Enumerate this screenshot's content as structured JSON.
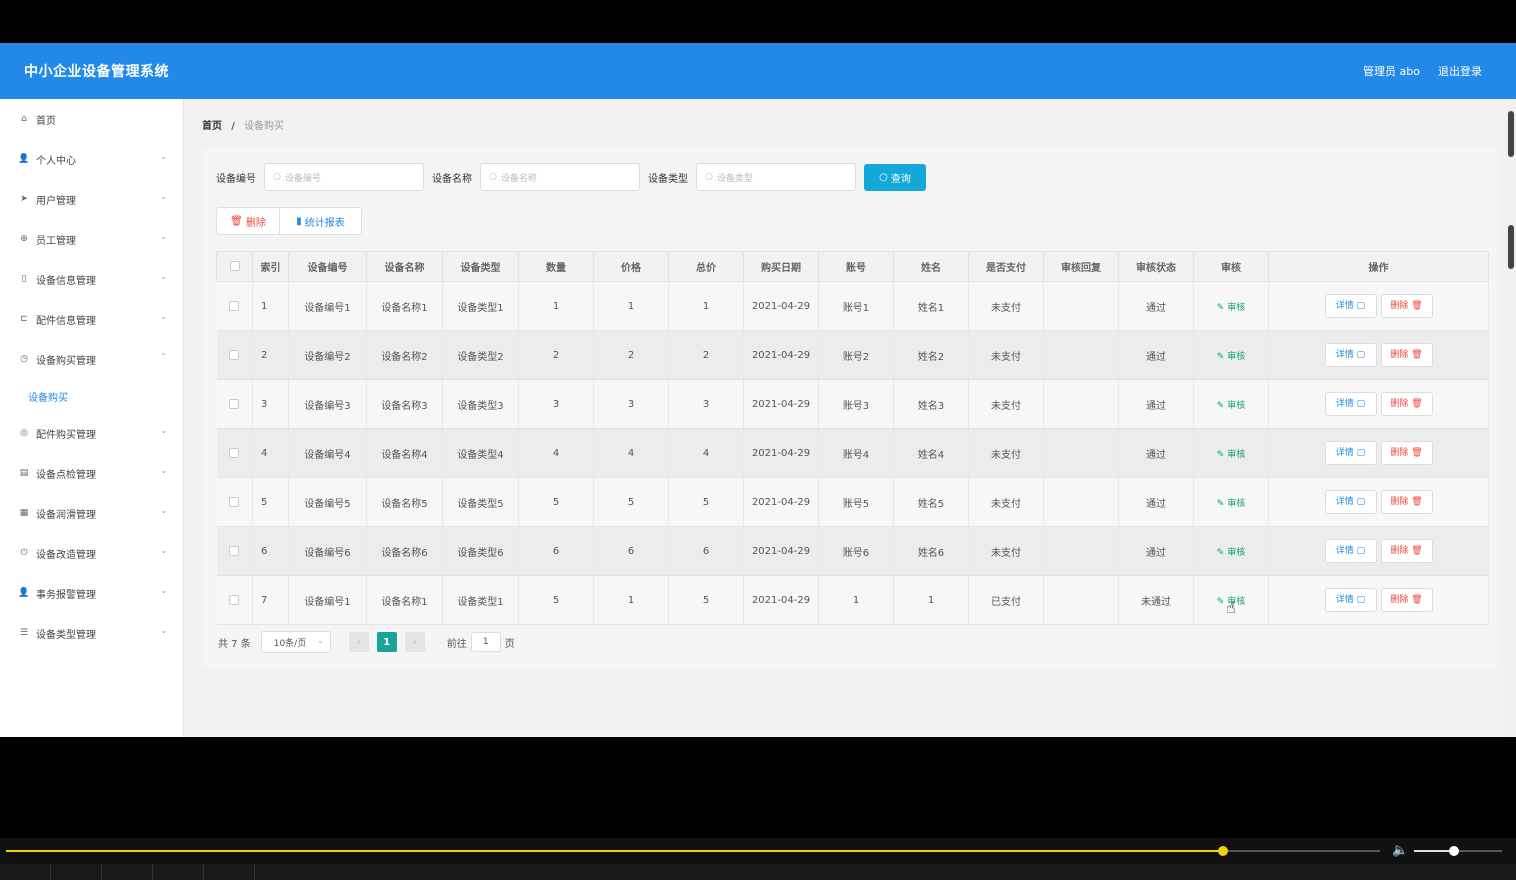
{
  "header": {
    "title": "中小企业设备管理系统",
    "user": "管理员 abo",
    "logout": "退出登录"
  },
  "sidebar": {
    "items": [
      {
        "label": "首页",
        "icon": "home-icon",
        "glyph": "⌂",
        "has_sub": false
      },
      {
        "label": "个人中心",
        "icon": "user-icon",
        "glyph": "👤",
        "has_sub": true
      },
      {
        "label": "用户管理",
        "icon": "send-icon",
        "glyph": "➤",
        "has_sub": true
      },
      {
        "label": "员工管理",
        "icon": "compass-icon",
        "glyph": "⊕",
        "has_sub": true
      },
      {
        "label": "设备信息管理",
        "icon": "phone-icon",
        "glyph": "▯",
        "has_sub": true
      },
      {
        "label": "配件信息管理",
        "icon": "crop-icon",
        "glyph": "⊏",
        "has_sub": true
      },
      {
        "label": "设备购买管理",
        "icon": "clock-icon",
        "glyph": "◷",
        "has_sub": true,
        "expanded": true
      },
      {
        "label": "配件购买管理",
        "icon": "dial-icon",
        "glyph": "◎",
        "has_sub": true
      },
      {
        "label": "设备点检管理",
        "icon": "clipboard-icon",
        "glyph": "▤",
        "has_sub": true
      },
      {
        "label": "设备润滑管理",
        "icon": "chart-icon",
        "glyph": "▦",
        "has_sub": true
      },
      {
        "label": "设备改造管理",
        "icon": "power-icon",
        "glyph": "⏻",
        "has_sub": true
      },
      {
        "label": "事务报警管理",
        "icon": "person-icon",
        "glyph": "👤",
        "has_sub": true
      },
      {
        "label": "设备类型管理",
        "icon": "list-icon",
        "glyph": "☰",
        "has_sub": true
      }
    ],
    "submenu_active": "设备购买"
  },
  "breadcrumb": {
    "home": "首页",
    "sep": "/",
    "current": "设备购买"
  },
  "search": {
    "fields": [
      {
        "label": "设备编号",
        "placeholder": "设备编号"
      },
      {
        "label": "设备名称",
        "placeholder": "设备名称"
      },
      {
        "label": "设备类型",
        "placeholder": "设备类型"
      }
    ],
    "query_button": "查询"
  },
  "actions": {
    "delete": "删除",
    "report": "统计报表"
  },
  "table": {
    "columns": [
      "索引",
      "设备编号",
      "设备名称",
      "设备类型",
      "数量",
      "价格",
      "总价",
      "购买日期",
      "账号",
      "姓名",
      "是否支付",
      "审核回复",
      "审核状态",
      "审核",
      "操作"
    ],
    "audit_link": "审核",
    "detail_button": "详情",
    "delete_button": "删除",
    "rows": [
      {
        "idx": "1",
        "code": "设备编号1",
        "name": "设备名称1",
        "type": "设备类型1",
        "qty": "1",
        "price": "1",
        "total": "1",
        "date": "2021-04-29",
        "account": "账号1",
        "person": "姓名1",
        "paid": "未支付",
        "reply": "",
        "status": "通过"
      },
      {
        "idx": "2",
        "code": "设备编号2",
        "name": "设备名称2",
        "type": "设备类型2",
        "qty": "2",
        "price": "2",
        "total": "2",
        "date": "2021-04-29",
        "account": "账号2",
        "person": "姓名2",
        "paid": "未支付",
        "reply": "",
        "status": "通过"
      },
      {
        "idx": "3",
        "code": "设备编号3",
        "name": "设备名称3",
        "type": "设备类型3",
        "qty": "3",
        "price": "3",
        "total": "3",
        "date": "2021-04-29",
        "account": "账号3",
        "person": "姓名3",
        "paid": "未支付",
        "reply": "",
        "status": "通过"
      },
      {
        "idx": "4",
        "code": "设备编号4",
        "name": "设备名称4",
        "type": "设备类型4",
        "qty": "4",
        "price": "4",
        "total": "4",
        "date": "2021-04-29",
        "account": "账号4",
        "person": "姓名4",
        "paid": "未支付",
        "reply": "",
        "status": "通过"
      },
      {
        "idx": "5",
        "code": "设备编号5",
        "name": "设备名称5",
        "type": "设备类型5",
        "qty": "5",
        "price": "5",
        "total": "5",
        "date": "2021-04-29",
        "account": "账号5",
        "person": "姓名5",
        "paid": "未支付",
        "reply": "",
        "status": "通过"
      },
      {
        "idx": "6",
        "code": "设备编号6",
        "name": "设备名称6",
        "type": "设备类型6",
        "qty": "6",
        "price": "6",
        "total": "6",
        "date": "2021-04-29",
        "account": "账号6",
        "person": "姓名6",
        "paid": "未支付",
        "reply": "",
        "status": "通过"
      },
      {
        "idx": "7",
        "code": "设备编号1",
        "name": "设备名称1",
        "type": "设备类型1",
        "qty": "5",
        "price": "1",
        "total": "5",
        "date": "2021-04-29",
        "account": "1",
        "person": "1",
        "paid": "已支付",
        "reply": "",
        "status": "未通过"
      }
    ]
  },
  "pager": {
    "total": "共 7 条",
    "page_size": "10条/页",
    "current_page": "1",
    "goto_label": "前往",
    "goto_value": "1",
    "page_suffix": "页"
  },
  "player": {
    "progress": 0.886,
    "volume": 0.45,
    "accent": "#f2d400"
  }
}
